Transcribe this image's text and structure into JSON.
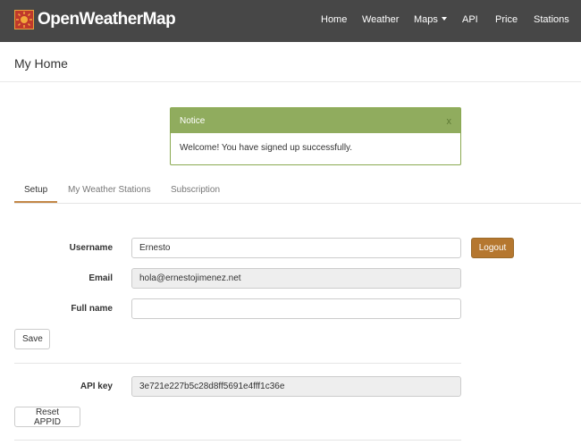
{
  "navbar": {
    "brand": "OpenWeatherMap",
    "items": [
      {
        "label": "Home"
      },
      {
        "label": "Weather"
      },
      {
        "label": "Maps"
      },
      {
        "label": "API"
      },
      {
        "label": "Price"
      },
      {
        "label": "Stations"
      }
    ]
  },
  "page": {
    "title": "My Home"
  },
  "notice": {
    "title": "Notice",
    "close": "x",
    "message": "Welcome! You have signed up successfully."
  },
  "tabs": [
    {
      "label": "Setup",
      "active": true
    },
    {
      "label": "My Weather Stations",
      "active": false
    },
    {
      "label": "Subscription",
      "active": false
    }
  ],
  "form": {
    "username": {
      "label": "Username",
      "value": "Ernesto"
    },
    "email": {
      "label": "Email",
      "value": "hola@ernestojimenez.net"
    },
    "full_name": {
      "label": "Full name",
      "value": ""
    },
    "logout_label": "Logout",
    "save_label": "Save"
  },
  "api": {
    "label": "API key",
    "value": "3e721e227b5c28d8ff5691e4fff1c36e",
    "reset_label": "Reset APPID"
  },
  "colors": {
    "navbar_bg": "#474747",
    "notice_header": "#90ac5e",
    "accent": "#b5772f"
  }
}
